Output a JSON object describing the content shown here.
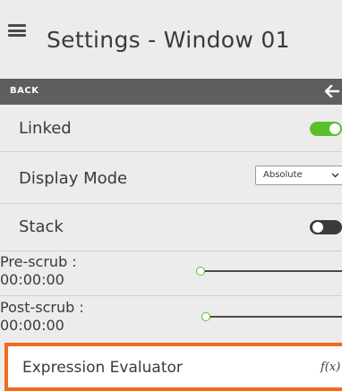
{
  "header": {
    "title": "Settings - Window 01",
    "menu_icon": "hamburger-icon"
  },
  "back_bar": {
    "label": "BACK",
    "icon": "arrow-left-icon"
  },
  "rows": {
    "linked": {
      "label": "Linked",
      "toggle_on": true
    },
    "display_mode": {
      "label": "Display Mode",
      "selected": "Absolute"
    },
    "stack": {
      "label": "Stack",
      "toggle_on": false
    }
  },
  "scrub": {
    "pre": {
      "line1": "Pre-scrub :",
      "line2": "00:00:00",
      "value": 0
    },
    "post": {
      "line1": "Post-scrub :",
      "line2": "00:00:00",
      "value": 0
    }
  },
  "expression": {
    "label": "Expression Evaluator",
    "icon": "fx-icon",
    "icon_text": "f(x)"
  },
  "colors": {
    "accent_green": "#5bbf2a",
    "highlight_orange": "#f26a1b",
    "back_bar": "#5e5e5e",
    "toggle_off": "#3a3a3a"
  }
}
